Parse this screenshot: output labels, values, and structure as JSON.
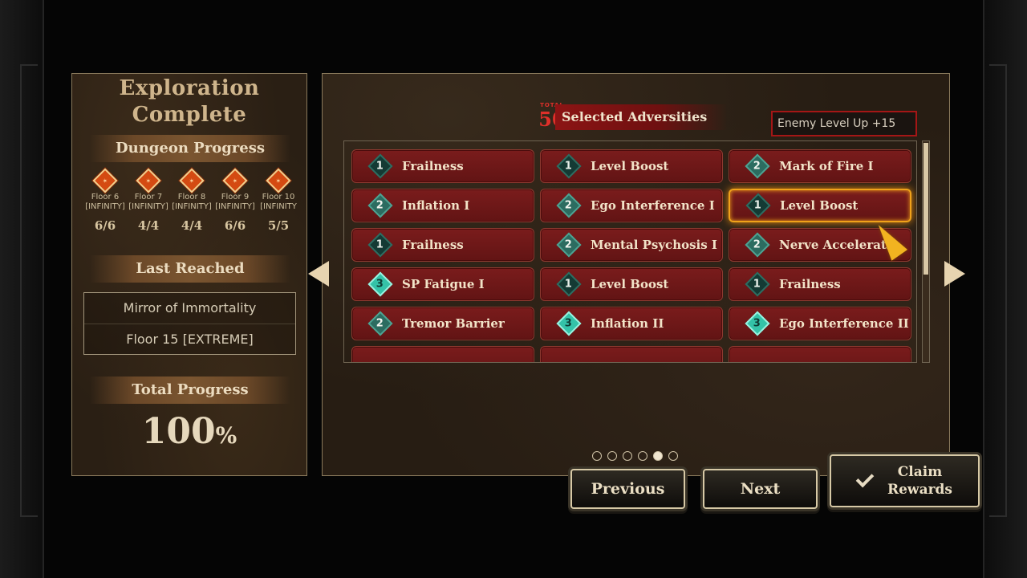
{
  "left_panel": {
    "title_line1": "Exploration",
    "title_line2": "Complete",
    "dungeon_progress_label": "Dungeon Progress",
    "floors": [
      {
        "name_line1": "Floor 6",
        "name_line2": "[INFINITY]",
        "count": "6/6"
      },
      {
        "name_line1": "Floor 7",
        "name_line2": "[INFINITY]",
        "count": "4/4"
      },
      {
        "name_line1": "Floor 8",
        "name_line2": "[INFINITY]",
        "count": "4/4"
      },
      {
        "name_line1": "Floor 9",
        "name_line2": "[INFINITY]",
        "count": "6/6"
      },
      {
        "name_line1": "Floor 10",
        "name_line2": "[INFINITY",
        "count": "5/5"
      }
    ],
    "last_reached_label": "Last Reached",
    "last_reached_location": "Mirror of Immortality",
    "last_reached_floor": "Floor 15 [EXTREME]",
    "total_progress_label": "Total Progress",
    "total_progress_value": "100",
    "total_progress_unit": "%"
  },
  "adversities": {
    "total_label": "TOTAL",
    "total_value": "50",
    "title": "Selected Adversities",
    "info_box": "Enemy Level Up +15",
    "items": [
      {
        "tier": "1",
        "label": "Frailness",
        "selected": false
      },
      {
        "tier": "1",
        "label": "Level Boost",
        "selected": false
      },
      {
        "tier": "2",
        "label": "Mark of Fire I",
        "selected": false
      },
      {
        "tier": "2",
        "label": "Inflation I",
        "selected": false
      },
      {
        "tier": "2",
        "label": "Ego Interference I",
        "selected": false
      },
      {
        "tier": "1",
        "label": "Level Boost",
        "selected": true
      },
      {
        "tier": "1",
        "label": "Frailness",
        "selected": false
      },
      {
        "tier": "2",
        "label": "Mental Psychosis I",
        "selected": false
      },
      {
        "tier": "2",
        "label": "Nerve Accelerati",
        "selected": false
      },
      {
        "tier": "3",
        "label": "SP Fatigue I",
        "selected": false
      },
      {
        "tier": "1",
        "label": "Level Boost",
        "selected": false
      },
      {
        "tier": "1",
        "label": "Frailness",
        "selected": false
      },
      {
        "tier": "2",
        "label": "Tremor Barrier",
        "selected": false
      },
      {
        "tier": "3",
        "label": "Inflation II",
        "selected": false
      },
      {
        "tier": "3",
        "label": "Ego Interference II",
        "selected": false
      }
    ],
    "scroll_fraction_visible": 0.6
  },
  "pagination": {
    "pages": 6,
    "active": 5
  },
  "buttons": {
    "previous": "Previous",
    "next": "Next",
    "claim": "Claim\nRewards"
  },
  "colors": {
    "card_red": "#6e1818",
    "selected_glow": "#f0a21a",
    "accent_red": "#e0302a"
  }
}
